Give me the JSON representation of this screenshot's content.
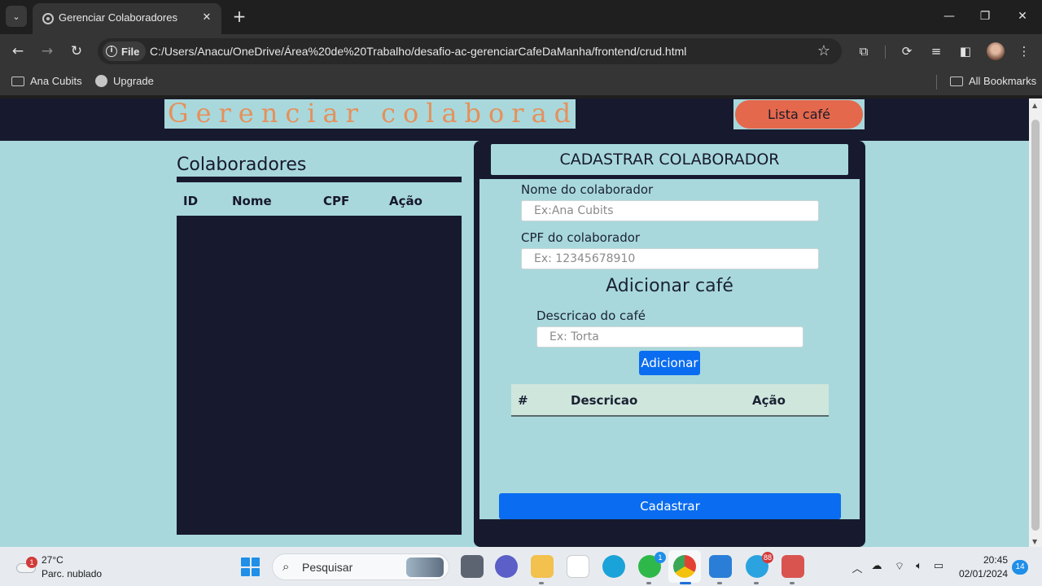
{
  "browser": {
    "tab_title": "Gerenciar Colaboradores",
    "file_chip": "File",
    "url": "C:/Users/Anacu/OneDrive/Área%20de%20Trabalho/desafio-ac-gerenciarCafeDaManha/frontend/crud.html",
    "bookmarks": [
      {
        "label": "Ana Cubits",
        "icon": "folder-icon"
      },
      {
        "label": "Upgrade",
        "icon": "globe-icon"
      }
    ],
    "all_bookmarks": "All Bookmarks"
  },
  "page": {
    "title": "Gerenciar colaboradores",
    "lista_button": "Lista café",
    "colaboradores": {
      "heading": "Colaboradores",
      "columns": [
        "ID",
        "Nome",
        "CPF",
        "Ação"
      ]
    },
    "form": {
      "heading": "CADASTRAR COLABORADOR",
      "nome_label": "Nome do colaborador",
      "nome_placeholder": "Ex:Ana Cubits",
      "cpf_label": "CPF do colaborador",
      "cpf_placeholder": "Ex: 12345678910",
      "add_cafe_heading": "Adicionar café",
      "cafe_label": "Descricao do café",
      "cafe_placeholder": "Ex: Torta",
      "add_button": "Adicionar",
      "cafe_columns": [
        "#",
        "Descricao",
        "Ação"
      ],
      "submit_button": "Cadastrar"
    }
  },
  "taskbar": {
    "weather_temp": "27°C",
    "weather_desc": "Parc. nublado",
    "weather_badge": "1",
    "search_label": "Pesquisar",
    "whatsapp_badge": "1",
    "telegram_badge": "88",
    "time": "20:45",
    "date": "02/01/2024",
    "notifications": "14"
  },
  "colors": {
    "page_bg": "#a8d8dc",
    "dark_navy": "#171a2e",
    "accent_orange": "#e4684c",
    "title_orange": "#e6905a",
    "primary_blue": "#0a6cf0"
  }
}
